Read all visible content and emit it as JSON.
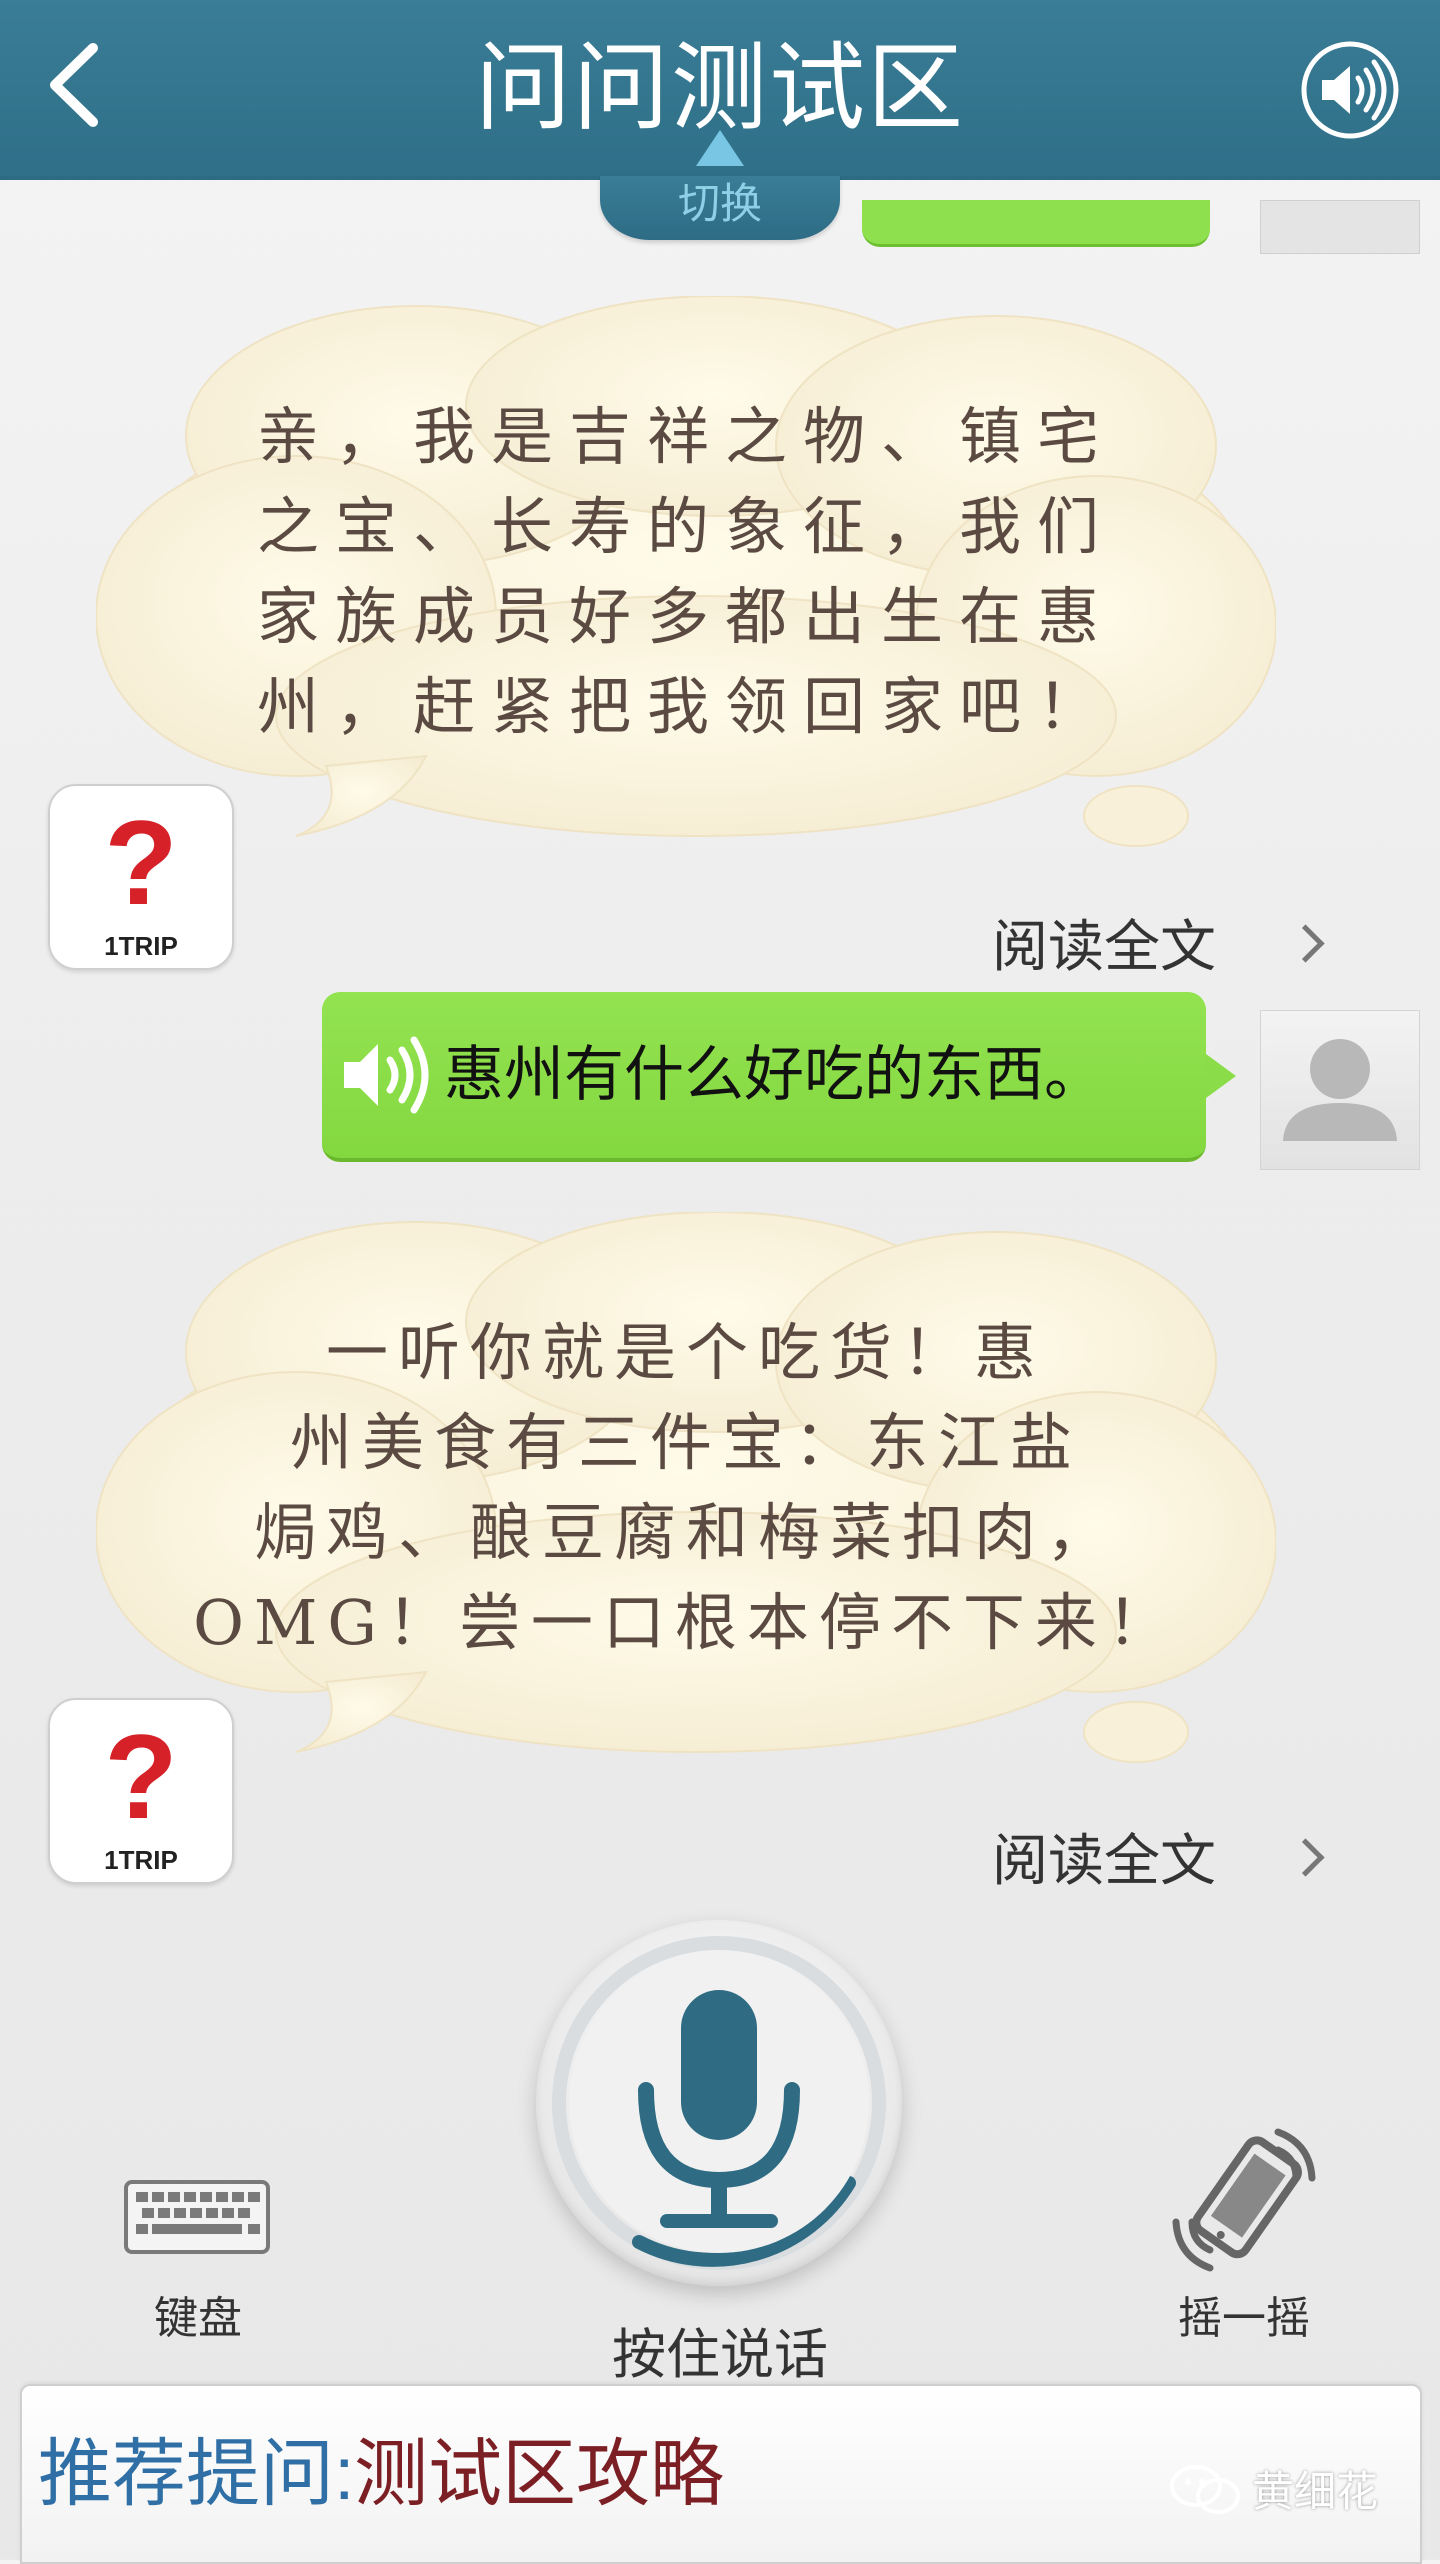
{
  "header": {
    "title": "问问测试区",
    "switch_label": "切换",
    "back_icon": "back-chevron-icon",
    "sound_icon": "speaker-icon"
  },
  "messages": [
    {
      "from": "bot",
      "text_lines": [
        "亲，我是吉祥之物、镇宅",
        "之宝、长寿的象征，我们",
        "家族成员好多都出生在惠",
        "州，赶紧把我领回家吧！"
      ],
      "read_more": "阅读全文"
    },
    {
      "from": "user",
      "text": "惠州有什么好吃的东西。"
    },
    {
      "from": "bot",
      "text_lines": [
        "一听你就是个吃货！惠",
        "州美食有三件宝：东江盐",
        "焗鸡、酿豆腐和梅菜扣肉，",
        "OMG！尝一口根本停不下来！"
      ],
      "read_more": "阅读全文"
    }
  ],
  "bot_avatar": {
    "mark": "?",
    "brand": "1TRIP",
    "mark_color": "#d62128"
  },
  "controls": {
    "keyboard_label": "键盘",
    "hold_label": "按住说话",
    "shake_label": "摇一摇"
  },
  "suggestion": {
    "label": "推荐提问:",
    "value": "测试区攻略"
  },
  "watermark": "黄细花",
  "colors": {
    "header": "#327590",
    "user_bubble": "#8add48",
    "mic": "#2f6c84",
    "suggest_label": "#2f6fa6",
    "suggest_value": "#7b1f24"
  }
}
